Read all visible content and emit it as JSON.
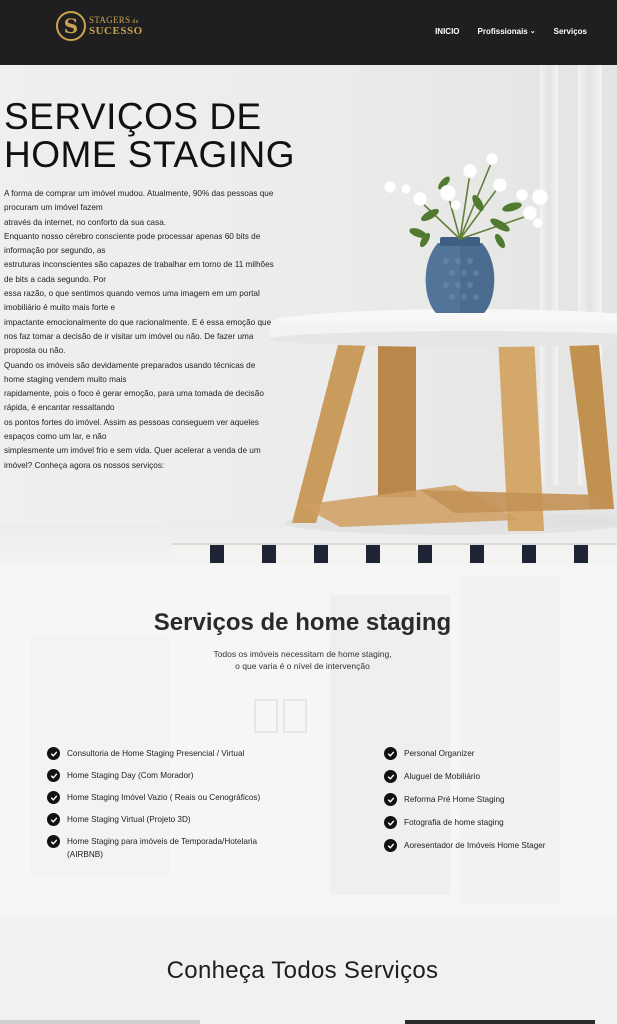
{
  "nav": {
    "logo_letter": "S",
    "logo_top": "STAGERS",
    "logo_de": "de",
    "logo_bottom": "SUCESSO",
    "menu": [
      {
        "label": "INICIO"
      },
      {
        "label": "Profissionais",
        "icon": "chevron-down-icon"
      },
      {
        "label": "Serviços"
      }
    ]
  },
  "hero": {
    "title_line1": "SERVIÇOS DE",
    "title_line2": "HOME STAGING",
    "paragraph_lines": [
      "A forma de comprar um imóvel mudou. Atualmente, 90% das pessoas que",
      "procuram um imóvel fazem",
      "através da internet, no conforto da sua casa.",
      "Enquanto nosso cérebro consciente pode processar apenas 60 bits de",
      "informação por segundo, as",
      "estruturas inconscientes são capazes de trabalhar em torno de 11 milhões",
      "de bits a cada segundo. Por",
      "essa razão, o que sentimos quando vemos uma imagem em um portal",
      "imobiliário é muito mais forte e",
      "impactante emocionalmente do que racionalmente. E é essa emoção que",
      "nos faz tomar a decisão de ir visitar um imóvel ou não. De fazer uma",
      "proposta ou não.",
      "Quando os imóveis são devidamente preparados usando técnicas de",
      "home staging vendem muito mais",
      "rapidamente, pois o foco é gerar emoção, para uma tomada de decisão",
      "rápida, é encantar ressaltando",
      "os pontos fortes do imóvel. Assim as pessoas conseguem ver aqueles",
      "espaços como um lar, e não",
      "simplesmente um imóvel frio e sem vida. Quer acelerar a venda de um",
      "imóvel? Conheça agora os nossos serviços:"
    ]
  },
  "services": {
    "title": "Serviços de home staging",
    "subtitle_line1": "Todos os imóveis necessitam de home staging,",
    "subtitle_line2": "o que varia é o nível de intervenção",
    "left_items": [
      "Consultoria de Home Staging Presencial / Virtual",
      "Home Staging Day (Com Morador)",
      "Home Staging Imóvel Vazio ( Reais ou Cenográficos)",
      "Home Staging Virtual (Projeto 3D)",
      "Home Staging para imóveis de Temporada/Hotelaria (AIRBNB)"
    ],
    "right_items": [
      "Personal Organizer",
      "Aluguel de Mobiliário",
      "Reforma Pré Home Staging",
      "Fotografia de home staging",
      "Aoresentador de Imóveis Home Stager"
    ]
  },
  "bottom": {
    "title": "Conheça Todos Serviços"
  },
  "colors": {
    "nav_bg": "#1f1f21",
    "logo_gold": "#c9a34e",
    "text_dark": "#222222"
  }
}
